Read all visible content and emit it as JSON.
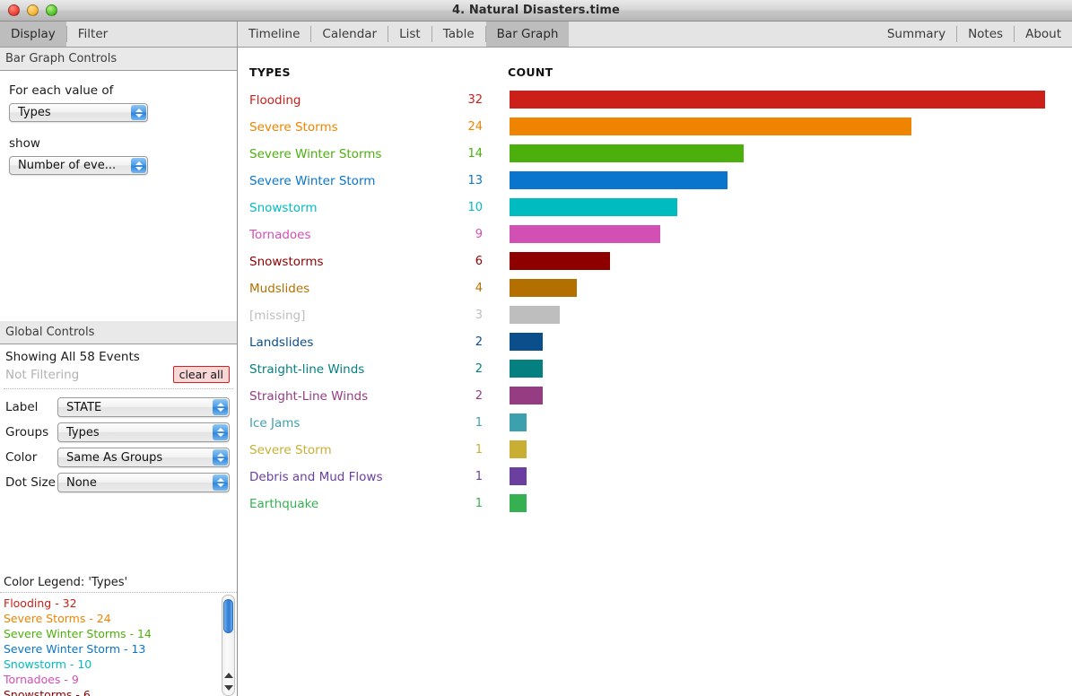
{
  "window": {
    "title": "4. Natural Disasters.time",
    "controls": [
      "close-button",
      "minimize-button",
      "zoom-button"
    ]
  },
  "left_tabs": {
    "items": [
      {
        "label": "Display",
        "selected": true
      },
      {
        "label": "Filter",
        "selected": false
      }
    ]
  },
  "view_tabs": {
    "items": [
      {
        "label": "Timeline",
        "selected": false
      },
      {
        "label": "Calendar",
        "selected": false
      },
      {
        "label": "List",
        "selected": false
      },
      {
        "label": "Table",
        "selected": false
      },
      {
        "label": "Bar Graph",
        "selected": true
      }
    ],
    "right_items": [
      {
        "label": "Summary"
      },
      {
        "label": "Notes"
      },
      {
        "label": "About"
      }
    ]
  },
  "bar_graph_controls": {
    "header": "Bar Graph Controls",
    "for_each_label": "For each value of",
    "for_each_value": "Types",
    "show_label": "show",
    "show_value": "Number of eve..."
  },
  "global_controls": {
    "header": "Global Controls",
    "showing": "Showing All 58 Events",
    "filtering": "Not Filtering",
    "clear_all": "clear all",
    "rows": [
      {
        "label": "Label",
        "value": "STATE"
      },
      {
        "label": "Groups",
        "value": "Types"
      },
      {
        "label": "Color",
        "value": "Same As Groups"
      },
      {
        "label": "Dot Size",
        "value": "None"
      }
    ]
  },
  "legend": {
    "title": "Color Legend: 'Types'",
    "items": [
      {
        "text": "Flooding - 32",
        "color": "#cc1f1a"
      },
      {
        "text": "Severe Storms - 24",
        "color": "#ee8400"
      },
      {
        "text": "Severe Winter Storms - 14",
        "color": "#4cb00c"
      },
      {
        "text": "Severe Winter Storm - 13",
        "color": "#0a75cc"
      },
      {
        "text": "Snowstorm - 10",
        "color": "#00bcc0"
      },
      {
        "text": "Tornadoes - 9",
        "color": "#d24fb4"
      },
      {
        "text": "Snowstorms - 6",
        "color": "#8e0000"
      }
    ]
  },
  "chart_data": {
    "type": "bar",
    "title": "",
    "orientation": "horizontal",
    "headers": {
      "category": "TYPES",
      "value": "COUNT"
    },
    "xlabel": "",
    "ylabel": "",
    "xlim": [
      0,
      32
    ],
    "grid": false,
    "legend_position": "sidebar",
    "categories": [
      "Flooding",
      "Severe Storms",
      "Severe Winter Storms",
      "Severe Winter Storm",
      "Snowstorm",
      "Tornadoes",
      "Snowstorms",
      "Mudslides",
      "[missing]",
      "Landslides",
      "Straight-line Winds",
      "Straight-Line Winds",
      "Ice Jams",
      "Severe Storm",
      "Debris and Mud Flows",
      "Earthquake"
    ],
    "values": [
      32,
      24,
      14,
      13,
      10,
      9,
      6,
      4,
      3,
      2,
      2,
      2,
      1,
      1,
      1,
      1
    ],
    "colors": [
      "#cc1f1a",
      "#ee8400",
      "#4cb00c",
      "#0a75cc",
      "#00bcc0",
      "#d24fb4",
      "#8e0000",
      "#b37000",
      "#bebebe",
      "#0a4f8c",
      "#058080",
      "#953c82",
      "#3da0ad",
      "#c8ae33",
      "#6a3fa0",
      "#36b152"
    ],
    "rows": [
      {
        "label": "Flooding",
        "value": 32,
        "color": "#cc1f1a"
      },
      {
        "label": "Severe Storms",
        "value": 24,
        "color": "#ee8400"
      },
      {
        "label": "Severe Winter Storms",
        "value": 14,
        "color": "#4cb00c"
      },
      {
        "label": "Severe Winter Storm",
        "value": 13,
        "color": "#0a75cc"
      },
      {
        "label": "Snowstorm",
        "value": 10,
        "color": "#00bcc0"
      },
      {
        "label": "Tornadoes",
        "value": 9,
        "color": "#d24fb4"
      },
      {
        "label": "Snowstorms",
        "value": 6,
        "color": "#8e0000"
      },
      {
        "label": "Mudslides",
        "value": 4,
        "color": "#b37000"
      },
      {
        "label": "[missing]",
        "value": 3,
        "color": "#bebebe"
      },
      {
        "label": "Landslides",
        "value": 2,
        "color": "#0a4f8c"
      },
      {
        "label": "Straight-line Winds",
        "value": 2,
        "color": "#058080"
      },
      {
        "label": "Straight-Line Winds",
        "value": 2,
        "color": "#953c82"
      },
      {
        "label": "Ice Jams",
        "value": 1,
        "color": "#3da0ad"
      },
      {
        "label": "Severe Storm",
        "value": 1,
        "color": "#c8ae33"
      },
      {
        "label": "Debris and Mud Flows",
        "value": 1,
        "color": "#6a3fa0"
      },
      {
        "label": "Earthquake",
        "value": 1,
        "color": "#36b152"
      }
    ]
  }
}
